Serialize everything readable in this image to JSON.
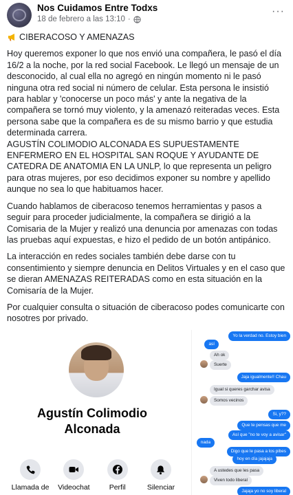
{
  "post": {
    "page_name": "Nos Cuidamos Entre Todxs",
    "date": "18 de febrero a las 13:10",
    "dot": "·",
    "more": "···",
    "title": "CIBERACOSO Y AMENAZAS",
    "paragraphs": [
      "Hoy queremos exponer lo que nos envió una compañera, le pasó el día 16/2 a la noche, por la red social Facebook. Le llegó un mensaje de un desconocido, al cual ella no agregó en ningún momento ni le pasó ninguna otra red social ni número de celular. Esta persona le insistió para hablar y 'conocerse un poco más' y ante la negativa de la compañera se tornó muy violento, y la amenazó reiteradas veces. Esta persona sabe que la compañera es de su mismo barrio y que estudia determinada carrera.",
      "AGUSTÍN COLIMODIO ALCONADA ES SUPUESTAMENTE ENFERMERO EN EL HOSPITAL SAN ROQUE Y AYUDANTE DE CATEDRA DE ANATOMIA EN LA UNLP, lo que representa un peligro para otras mujeres, por eso decidimos exponer su nombre y apellido aunque no sea lo que habituamos hacer.",
      "Cuando hablamos de ciberacoso tenemos herramientas y pasos a seguir para proceder judicialmente, la compañera se dirigió a la Comisaria de la Mujer y realizó una denuncia por amenazas con todas las pruebas aquí expuestas, e hizo el pedido de un botón antipánico.",
      "La interacción en redes sociales también debe darse con tu consentimiento y siempre denuncia en Delitos Virtuales y en el caso que se dieran AMENAZAS REITERADAS como en esta situación en la Comisaría de la Mujer.",
      "Por cualquier consulta o situación de ciberacoso podes comunicarte con nosotres por privado."
    ]
  },
  "profile": {
    "name_line1": "Agustín Colimodio",
    "name_line2": "Alconada",
    "actions": [
      {
        "label": "Llamada de",
        "icon": "phone-icon"
      },
      {
        "label": "Videochat",
        "icon": "video-camera-icon"
      },
      {
        "label": "Perfil",
        "icon": "facebook-icon"
      },
      {
        "label": "Silenciar",
        "icon": "bell-icon"
      }
    ]
  },
  "chat": {
    "messages": [
      {
        "dir": "out",
        "text": "Yo la verdad no. Estoy bien"
      },
      {
        "dir": "out",
        "text": "así"
      },
      {
        "dir": "in",
        "text": "Ah ok"
      },
      {
        "dir": "in",
        "text": "Suerte"
      },
      {
        "dir": "out",
        "text": "Jaja igualmente!! Chau"
      },
      {
        "dir": "in",
        "text": "Igual si queres garchar avisa"
      },
      {
        "dir": "in",
        "text": "Somos vecinos"
      },
      {
        "dir": "out",
        "text": "Si, y??"
      },
      {
        "dir": "out",
        "text": "Que te pensas que me"
      },
      {
        "dir": "out",
        "text": "Así que \"no te voy a avisar\""
      },
      {
        "dir": "out",
        "text": "nada"
      },
      {
        "dir": "out",
        "text": "Digo que le pasa a los pibes"
      },
      {
        "dir": "out",
        "text": "hoy en día jajajaja"
      },
      {
        "dir": "in",
        "text": "A ustedes que les pasa"
      },
      {
        "dir": "in",
        "text": "Viven todo liberal"
      },
      {
        "dir": "out",
        "text": "Jajaja yo no soy liberal"
      }
    ]
  },
  "colors": {
    "messenger_blue": "#1877f2",
    "bubble_gray": "#e4e6eb",
    "meta_gray": "#65676b"
  }
}
